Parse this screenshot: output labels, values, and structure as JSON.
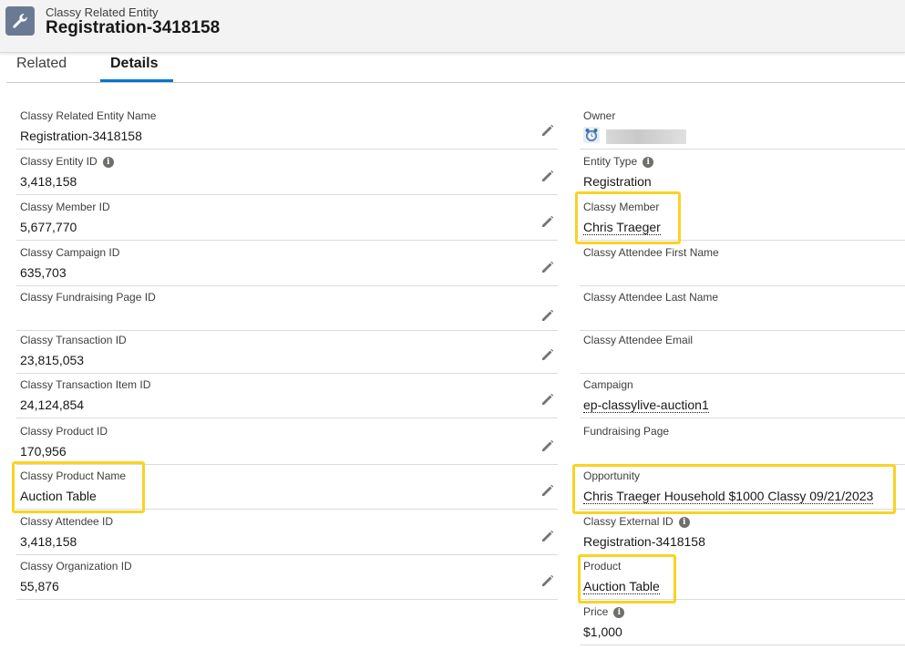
{
  "header": {
    "object_type": "Classy Related Entity",
    "record_name": "Registration-3418158",
    "icon": "wrench-icon"
  },
  "tabs": [
    {
      "label": "Related",
      "active": false
    },
    {
      "label": "Details",
      "active": true
    }
  ],
  "left_fields": [
    {
      "label": "Classy Related Entity Name",
      "value": "Registration-3418158"
    },
    {
      "label": "Classy Entity ID",
      "value": "3,418,158",
      "info": true
    },
    {
      "label": "Classy Member ID",
      "value": "5,677,770"
    },
    {
      "label": "Classy Campaign ID",
      "value": "635,703"
    },
    {
      "label": "Classy Fundraising Page ID",
      "value": ""
    },
    {
      "label": "Classy Transaction ID",
      "value": "23,815,053"
    },
    {
      "label": "Classy Transaction Item ID",
      "value": "24,124,854"
    },
    {
      "label": "Classy Product ID",
      "value": "170,956"
    },
    {
      "label": "Classy Product Name",
      "value": "Auction Table"
    },
    {
      "label": "Classy Attendee ID",
      "value": "3,418,158"
    },
    {
      "label": "Classy Organization ID",
      "value": "55,876"
    }
  ],
  "right_fields": [
    {
      "label": "Owner",
      "value": ""
    },
    {
      "label": "Entity Type",
      "value": "Registration",
      "info": true
    },
    {
      "label": "Classy Member",
      "value": "Chris Traeger",
      "link": true
    },
    {
      "label": "Classy Attendee First Name",
      "value": ""
    },
    {
      "label": "Classy Attendee Last Name",
      "value": ""
    },
    {
      "label": "Classy Attendee Email",
      "value": ""
    },
    {
      "label": "Campaign",
      "value": "ep-classylive-auction1",
      "link": true
    },
    {
      "label": "Fundraising Page",
      "value": ""
    },
    {
      "label": "Opportunity",
      "value": "Chris Traeger Household $1000 Classy 09/21/2023",
      "link": true
    },
    {
      "label": "Classy External ID",
      "value": "Registration-3418158",
      "info": true
    },
    {
      "label": "Product",
      "value": "Auction Table",
      "link": true
    },
    {
      "label": "Price",
      "value": "$1,000",
      "info": true
    }
  ],
  "colors": {
    "highlight": "#f8d323",
    "tab_active": "#0176d3",
    "header_bg": "#f3f3f3"
  }
}
